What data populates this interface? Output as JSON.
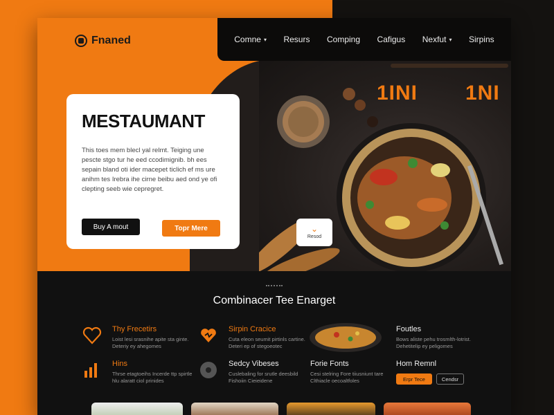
{
  "brand": {
    "name": "Fnaned"
  },
  "nav": [
    {
      "label": "Comne",
      "has_menu": true
    },
    {
      "label": "Resurs",
      "has_menu": false
    },
    {
      "label": "Comping",
      "has_menu": false
    },
    {
      "label": "Cafigus",
      "has_menu": false
    },
    {
      "label": "Nexfut",
      "has_menu": true
    },
    {
      "label": "Sirpins",
      "has_menu": false
    }
  ],
  "hero": {
    "title": "MESTAUMANT",
    "description": "This toes mem blecl yal relmt. Teiging une pescte stgo tur he eed ccodimignib. bh ees sepain bland oti ider macepet ticlich ef ms ure anihm tes Irebra ihe cirne beibu aed ond ye ofi clepting seeb wie cepregret.",
    "primary_button": "Buy A mout",
    "secondary_button": "Topr Mere",
    "word_1": "1INI",
    "word_2": "1NI",
    "scroll_label": "Resod"
  },
  "section": {
    "title": "Combinacer Tee Enarget"
  },
  "features": [
    {
      "title": "Thy Frecetirs",
      "desc": "Loist lesi srasnihe apite sta ginte. Deteriy ey ahegomes",
      "icon": "heart-icon"
    },
    {
      "title": "Sirpin Cracice",
      "desc": "Cuta eleon seumit pirtinls cartine. Deteri ep of stegoeotec",
      "icon": "heart-spark-icon"
    },
    {
      "title": "Foutles",
      "desc": "Bows aliste pehu trosmlth-lotrist. Dehetitelip ey peligomes",
      "icon": "food-plate-icon"
    },
    {
      "title": "Hins",
      "desc": "Thrse etagtoeihs Incerde ttp spirtle hlu alaratt ciol prinides",
      "icon": "bar-chart-icon"
    },
    {
      "title": "Sedcy Vibeses",
      "desc": "Cuslebaling for srutle deesbild Fishoiin Cieieidene",
      "icon": "disc-icon"
    },
    {
      "title": "Forie Fonts",
      "desc": "Cesi stelring Fore tiiusniunt tare Clthiacle oecoaltfoles",
      "icon": ""
    },
    {
      "title": "Hom Remnl",
      "desc": "",
      "icon": ""
    }
  ],
  "feature_buttons": {
    "primary": "Erpr Tece",
    "secondary": "Cendsr"
  },
  "colors": {
    "accent": "#f07a12",
    "dark": "#111111"
  }
}
